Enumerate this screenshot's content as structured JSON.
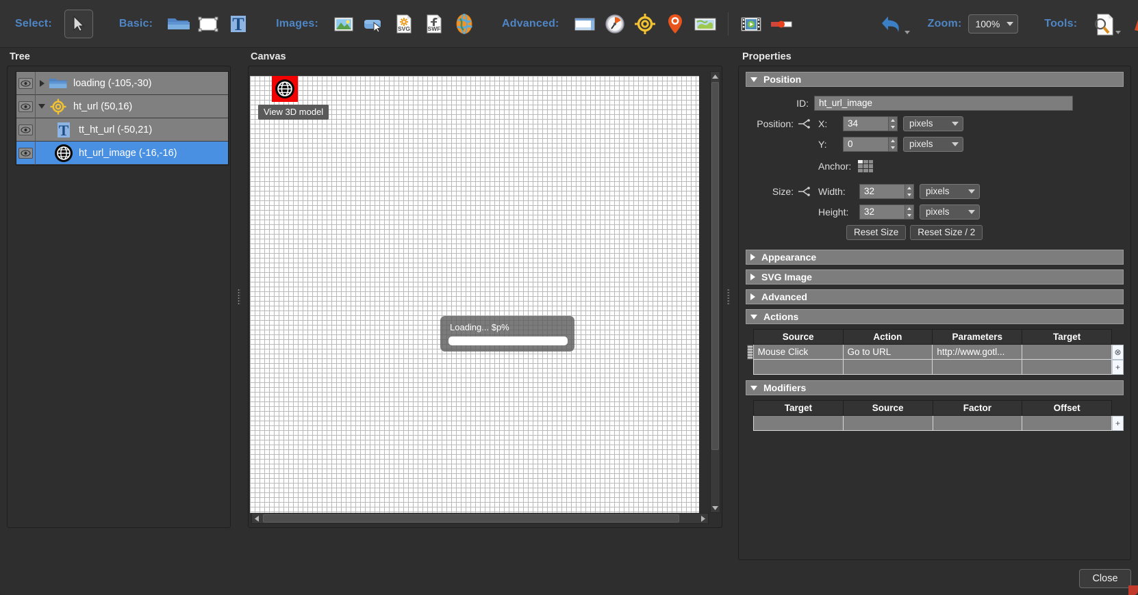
{
  "toolbar": {
    "select_label": "Select:",
    "basic_label": "Basic:",
    "images_label": "Images:",
    "advanced_label": "Advanced:",
    "zoom_label": "Zoom:",
    "zoom_value": "100%",
    "tools_label": "Tools:",
    "icons": {
      "cursor": "cursor-arrow-icon",
      "folder": "folder-icon",
      "rect": "rectangle-icon",
      "text": "text-tool-icon",
      "image": "image-icon",
      "button": "button-icon",
      "svg": "svg-file-icon",
      "swf": "swf-file-icon",
      "globe": "globe-image-icon",
      "panel": "panel-icon",
      "gauge": "gauge-icon",
      "target": "target-icon",
      "pin": "map-pin-icon",
      "map": "map-icon",
      "video": "video-icon",
      "slider": "slider-icon",
      "undo": "undo-arrow-icon",
      "inspect": "inspect-document-icon",
      "palette": "color-palette-icon",
      "toolbox": "toolbox-icon"
    },
    "accent_color": "#4f86c6"
  },
  "tree": {
    "title": "Tree",
    "items": [
      {
        "label": "loading (-105,-30)",
        "icon": "folder-icon",
        "twisty": "right",
        "depth": 0,
        "selected": false
      },
      {
        "label": "ht_url (50,16)",
        "icon": "target-icon",
        "twisty": "down",
        "depth": 0,
        "selected": false
      },
      {
        "label": "tt_ht_url (-50,21)",
        "icon": "text-tool-icon",
        "twisty": "none",
        "depth": 1,
        "selected": false
      },
      {
        "label": "ht_url_image (-16,-16)",
        "icon": "globe-icon",
        "twisty": "none",
        "depth": 1,
        "selected": true
      }
    ]
  },
  "canvas": {
    "title": "Canvas",
    "stage_object": {
      "name": "globe-object",
      "tooltip": "View 3D model"
    },
    "loading_overlay": {
      "text": "Loading... $p%",
      "progress": 100
    }
  },
  "properties": {
    "title": "Properties",
    "sections": {
      "position": {
        "label": "Position",
        "expanded": true
      },
      "appearance": {
        "label": "Appearance",
        "expanded": false
      },
      "svg_image": {
        "label": "SVG Image",
        "expanded": false
      },
      "advanced": {
        "label": "Advanced",
        "expanded": false
      },
      "actions": {
        "label": "Actions",
        "expanded": true
      },
      "modifiers": {
        "label": "Modifiers",
        "expanded": true
      }
    },
    "position": {
      "id_label": "ID:",
      "id_value": "ht_url_image",
      "position_label": "Position:",
      "x_label": "X:",
      "x_value": "34",
      "x_unit": "pixels",
      "y_label": "Y:",
      "y_value": "0",
      "y_unit": "pixels",
      "anchor_label": "Anchor:",
      "anchor_selected_index": 0,
      "size_label": "Size:",
      "width_label": "Width:",
      "width_value": "32",
      "width_unit": "pixels",
      "height_label": "Height:",
      "height_value": "32",
      "height_unit": "pixels",
      "reset_size": "Reset Size",
      "reset_size_half": "Reset Size / 2"
    },
    "actions_table": {
      "columns": [
        "Source",
        "Action",
        "Parameters",
        "Target"
      ],
      "rows": [
        [
          "Mouse Click",
          "Go to URL",
          "http://www.gotl...",
          ""
        ],
        [
          "",
          "",
          "",
          ""
        ]
      ],
      "delete_label": "⊗",
      "add_label": "+"
    },
    "modifiers_table": {
      "columns": [
        "Target",
        "Source",
        "Factor",
        "Offset"
      ],
      "rows": [
        [
          "",
          "",
          "",
          ""
        ]
      ],
      "add_label": "+"
    }
  },
  "footer": {
    "close_label": "Close"
  }
}
